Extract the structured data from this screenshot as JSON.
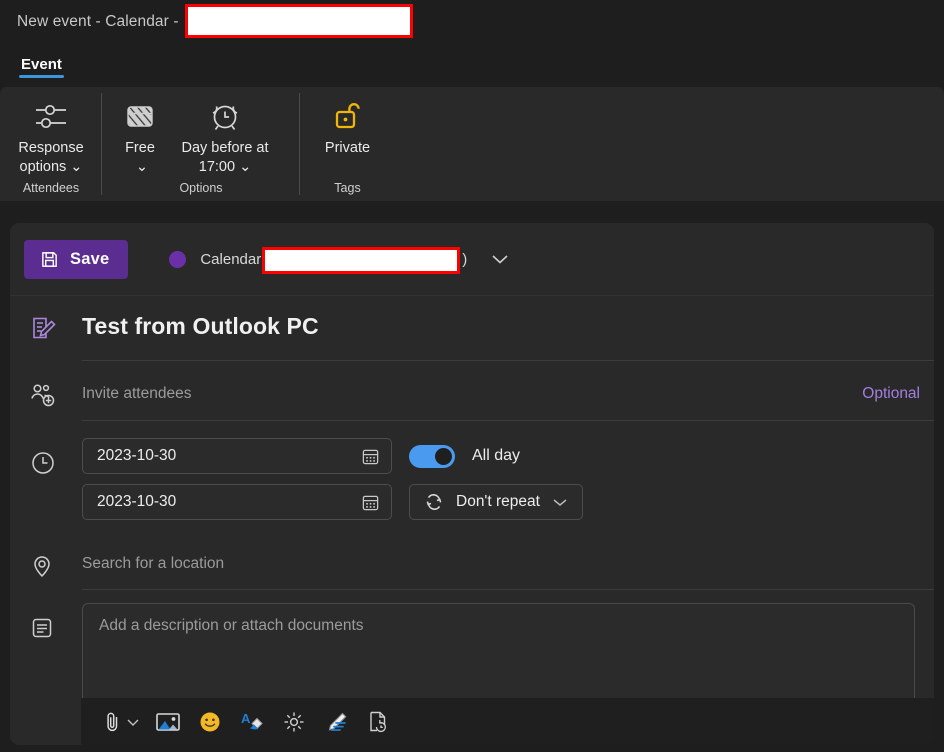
{
  "window": {
    "title_prefix": "New event - Calendar -",
    "redacted_title": ""
  },
  "ribbon": {
    "tabs": [
      {
        "label": "Event",
        "active": true
      }
    ],
    "groups": [
      {
        "name": "Attendees",
        "label": "Attendees",
        "items": [
          {
            "icon": "response-options-icon",
            "label": "Response options",
            "has_chevron": true
          }
        ]
      },
      {
        "name": "Options",
        "label": "Options",
        "items": [
          {
            "icon": "free-busy-icon",
            "label": "Free",
            "has_chevron": true
          },
          {
            "icon": "alarm-clock-icon",
            "label": "Day before at 17:00",
            "has_chevron": true
          }
        ]
      },
      {
        "name": "Tags",
        "label": "Tags",
        "items": [
          {
            "icon": "unlock-padlock-icon",
            "label": "Private",
            "has_chevron": false
          }
        ]
      }
    ]
  },
  "form": {
    "save_label": "Save",
    "calendar_label": "Calendar",
    "calendar_redacted": "",
    "calendar_paren": ")",
    "event_title": "Test from Outlook PC",
    "attendees_placeholder": "Invite attendees",
    "optional_label": "Optional",
    "start_date": "2023-10-30",
    "end_date": "2023-10-30",
    "all_day_label": "All day",
    "all_day_on": true,
    "repeat_label": "Don't repeat",
    "location_placeholder": "Search for a location",
    "description_placeholder": "Add a description or attach documents"
  },
  "description_toolbar": {
    "items": [
      {
        "icon": "attach-file-icon",
        "label": "Attach file",
        "has_chevron": true
      },
      {
        "icon": "insert-picture-icon",
        "label": "Insert picture"
      },
      {
        "icon": "emoji-icon",
        "label": "Emoji"
      },
      {
        "icon": "format-painter-icon",
        "label": "Format painter"
      },
      {
        "icon": "dictate-icon",
        "label": "Dictate"
      },
      {
        "icon": "ink-pen-icon",
        "label": "Draw"
      },
      {
        "icon": "document-history-icon",
        "label": "Document history"
      }
    ]
  },
  "colors": {
    "page_background": "#1e1e1e",
    "card_background": "#292929",
    "accent_purple": "#5b2d90",
    "calendar_dot": "#6b30a8",
    "tab_underline": "#3a96dd",
    "toggle_on": "#4a9bf0",
    "optional_link": "#a47ee0",
    "redaction_border": "#ff0000",
    "redaction_fill": "#ffffff",
    "tag_icon_yellow": "#f2b705"
  }
}
